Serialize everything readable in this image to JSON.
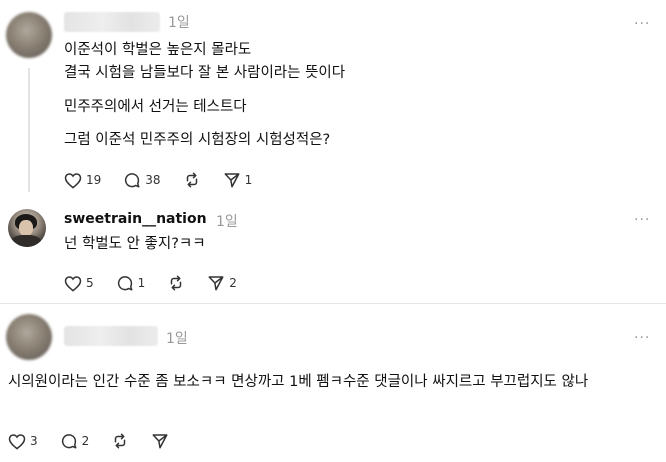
{
  "posts": [
    {
      "time": "1일",
      "more": "···",
      "lines": [
        "이준석이 학벌은 높은지 몰라도",
        "결국 시험을 남들보다 잘 본 사람이라는 뜻이다",
        "민주주의에서 선거는 테스트다",
        "그럼 이준석 민주주의 시험장의 시험성적은?"
      ],
      "like_count": "19",
      "reply_count": "38",
      "share_count": "1"
    },
    {
      "username": "sweetrain__nation",
      "time": "1일",
      "more": "···",
      "lines": [
        "넌 학벌도 안 좋지?ㅋㅋ"
      ],
      "like_count": "5",
      "reply_count": "1",
      "share_count": "2"
    },
    {
      "time": "1일",
      "more": "···",
      "text": "시의원이라는 인간 수준 좀 보소ㅋㅋ 면상까고 1베 펨ㅋ수준 댓글이나 싸지르고 부끄럽지도 않나",
      "like_count": "3",
      "reply_count": "2"
    }
  ],
  "icons": [
    "heart-icon",
    "comment-icon",
    "repost-icon",
    "send-icon"
  ]
}
